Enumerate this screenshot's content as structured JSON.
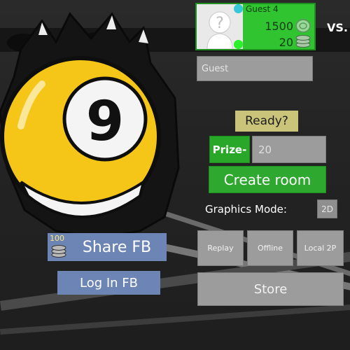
{
  "player": {
    "name": "Guest 4",
    "coins": "1500",
    "chips": "20"
  },
  "vs_label": "VS.",
  "opponent": {
    "name_value": "Guest"
  },
  "ready_label": "Ready?",
  "prize": {
    "label": "Prize-",
    "value": "20"
  },
  "create_room_label": "Create room",
  "graphics": {
    "label": "Graphics Mode:",
    "mode": "2D"
  },
  "buttons": {
    "replay": "Replay",
    "offline": "Offline",
    "local2p": "Local 2P",
    "store": "Store"
  },
  "facebook": {
    "share_label": "Share FB",
    "share_reward": "100",
    "login_label": "Log In FB"
  },
  "logo": {
    "ball_number": "9"
  },
  "colors": {
    "green": "#2fa82f",
    "fb_blue": "#6d85b4",
    "ball_yellow": "#f5c518",
    "panel_gray": "#9c9c9c"
  }
}
